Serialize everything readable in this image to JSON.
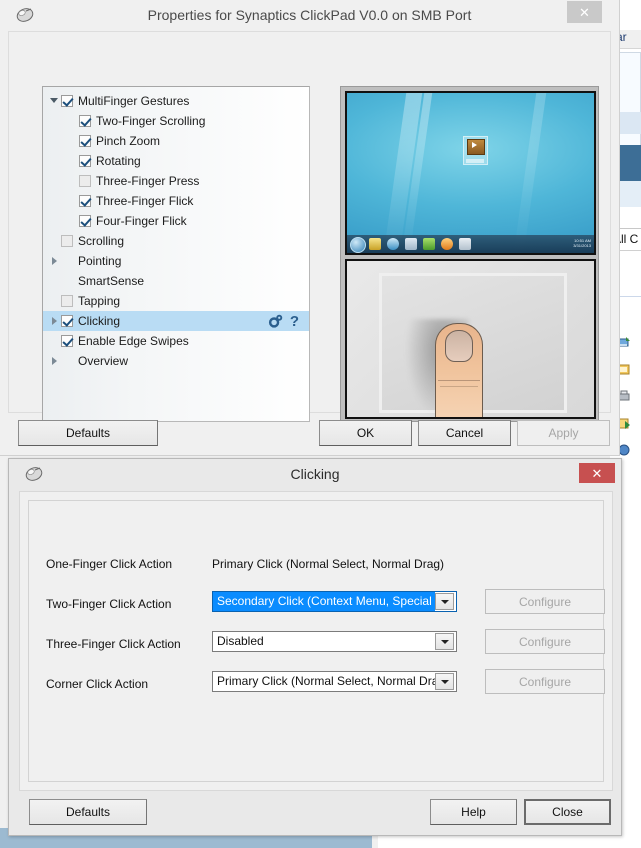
{
  "background": {
    "right_label": "-ar",
    "all_label": "All C",
    "icon_names": [
      "network-drive-icon",
      "folder-icon",
      "printer-icon",
      "shared-folder-icon",
      "blue-item-icon"
    ]
  },
  "main_window": {
    "title": "Properties for Synaptics ClickPad V0.0 on SMB Port",
    "icon": "mouse-icon",
    "close_label": "✕",
    "tree": [
      {
        "label": "MultiFinger Gestures",
        "level": 1,
        "checkbox": "checked",
        "twisty": "expanded",
        "selected": false
      },
      {
        "label": "Two-Finger Scrolling",
        "level": 2,
        "checkbox": "checked",
        "twisty": "none",
        "selected": false
      },
      {
        "label": "Pinch Zoom",
        "level": 2,
        "checkbox": "checked",
        "twisty": "none",
        "selected": false
      },
      {
        "label": "Rotating",
        "level": 2,
        "checkbox": "checked",
        "twisty": "none",
        "selected": false
      },
      {
        "label": "Three-Finger Press",
        "level": 2,
        "checkbox": "unchecked",
        "twisty": "none",
        "selected": false
      },
      {
        "label": "Three-Finger Flick",
        "level": 2,
        "checkbox": "checked",
        "twisty": "none",
        "selected": false
      },
      {
        "label": "Four-Finger Flick",
        "level": 2,
        "checkbox": "checked",
        "twisty": "none",
        "selected": false
      },
      {
        "label": "Scrolling",
        "level": 1,
        "checkbox": "unchecked",
        "twisty": "none",
        "selected": false
      },
      {
        "label": "Pointing",
        "level": 1,
        "checkbox": "none",
        "twisty": "collapsed",
        "selected": false
      },
      {
        "label": "SmartSense",
        "level": 1,
        "checkbox": "none",
        "twisty": "none",
        "selected": false
      },
      {
        "label": "Tapping",
        "level": 1,
        "checkbox": "unchecked",
        "twisty": "none",
        "selected": false
      },
      {
        "label": "Clicking",
        "level": 1,
        "checkbox": "checked",
        "twisty": "collapsed",
        "selected": true,
        "row_icons": [
          "gear-icon",
          "help-icon"
        ]
      },
      {
        "label": "Enable Edge Swipes",
        "level": 1,
        "checkbox": "checked",
        "twisty": "none",
        "selected": false
      },
      {
        "label": "Overview",
        "level": 1,
        "checkbox": "none",
        "twisty": "collapsed",
        "selected": false
      }
    ],
    "help_glyph": "?",
    "buttons": {
      "defaults": "Defaults",
      "ok": "OK",
      "cancel": "Cancel",
      "apply": "Apply"
    },
    "preview": {
      "desktop_alt": "windows-desktop-preview",
      "touchpad_alt": "finger-on-touchpad-preview"
    }
  },
  "clicking_dialog": {
    "title": "Clicking",
    "icon": "mouse-icon",
    "close_label": "✕",
    "rows": [
      {
        "label": "One-Finger Click Action",
        "type": "static",
        "value": "Primary Click (Normal Select, Normal Drag)",
        "configure": null,
        "configure_disabled": true
      },
      {
        "label": "Two-Finger Click Action",
        "type": "combo",
        "value": "Secondary Click (Context Menu, Special Drag)",
        "highlighted": true,
        "configure": "Configure",
        "configure_disabled": true
      },
      {
        "label": "Three-Finger Click Action",
        "type": "combo",
        "value": "Disabled",
        "highlighted": false,
        "configure": "Configure",
        "configure_disabled": true
      },
      {
        "label": "Corner Click Action",
        "type": "combo",
        "value": "Primary Click (Normal Select, Normal Drag)",
        "highlighted": false,
        "configure": "Configure",
        "configure_disabled": true
      }
    ],
    "buttons": {
      "defaults": "Defaults",
      "help": "Help",
      "close": "Close"
    }
  },
  "colors": {
    "selection_blue": "#b9dcf4",
    "combo_highlight": "#0a8cff",
    "close_red": "#c75050",
    "window_bg": "#f0f0f0"
  }
}
